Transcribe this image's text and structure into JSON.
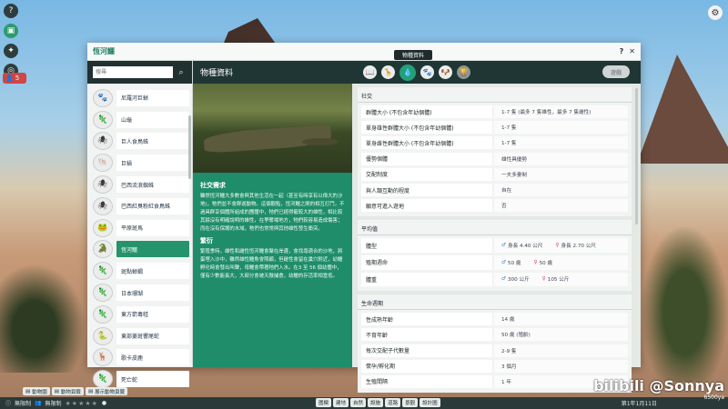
{
  "hud": {
    "guest_count": "5",
    "settings_icon": "gear-icon"
  },
  "window": {
    "title": "恆河鱷",
    "help": "?",
    "close": "✕",
    "tooltip": "物種資料"
  },
  "search": {
    "value": "",
    "placeholder": "搜尋"
  },
  "species": [
    {
      "icon": "🐾",
      "label": "尼羅河巨蜥"
    },
    {
      "icon": "🦎",
      "label": "山龜"
    },
    {
      "icon": "🕷",
      "label": "巨人食鳥蛛"
    },
    {
      "icon": "🐚",
      "label": "巨蝸"
    },
    {
      "icon": "🕷",
      "label": "巴西流浪蜘蛛"
    },
    {
      "icon": "🕷",
      "label": "巴西紅臭粉紅食鳥蛛"
    },
    {
      "icon": "🐸",
      "label": "平原斑馬"
    },
    {
      "icon": "🐊",
      "label": "恆河鱷",
      "selected": true
    },
    {
      "icon": "🦎",
      "label": "斑點蜥蝎"
    },
    {
      "icon": "🦎",
      "label": "日本珊瑚"
    },
    {
      "icon": "🦎",
      "label": "東方箭毒蛙"
    },
    {
      "icon": "🐍",
      "label": "東部菱斑響尾蛇"
    },
    {
      "icon": "🦌",
      "label": "歌卡皮鹿"
    },
    {
      "icon": "🦎",
      "label": "死亡蛇"
    }
  ],
  "middle": {
    "header": "物種資料",
    "social_title": "社交需求",
    "social_text": "雖然恆河鱷大多數會與其他生活在一起（甚至有時享有以偉大的沙地)，牠們並不會群遊動物。這個觀點，恆河鱷之間的相互打鬥，不過具群享個體所組成的團體中，牠們已經得寵較大的雄性，相比較其餘沒有明確說明的雄性，在爭奪場地方，牠們較容易造成傷害；而在沒有保護的水域，牠們也常常與其他雄性發生衝突。",
    "breeding_title": "繁衍",
    "breeding_text": "繁殖季時，雄性和雌性恆河鱷會聚在岸邊，會找尋適合的沙地，將蛋埋入沙中，雖然雄性鱷魚會照顧，但雌性會留在巢穴附近，幼鱷孵化時會發出叫聲，母鱷會帶著牠們入水。在3 至 56 個幼體中，僅有少數能長大，大部分會被天敵捕食，幼鱷的存活率相當低。"
  },
  "tabs": [
    {
      "icon": "📖",
      "name": "book-icon"
    },
    {
      "icon": "🦒",
      "name": "giraffe-icon"
    },
    {
      "icon": "💧",
      "name": "droplet-icon",
      "active": true
    },
    {
      "icon": "🐾",
      "name": "paw-icon"
    },
    {
      "icon": "🐶",
      "name": "pet-icon"
    },
    {
      "icon": "🏆",
      "name": "trophy-icon",
      "dim": true
    }
  ],
  "locked_label": "遊戲",
  "social": {
    "title": "社交",
    "rows": [
      {
        "k": "群體大小 (不包含年幼個體)",
        "v": "1-7 隻 (最多 7 隻雄性，最多 7 隻雌性)"
      },
      {
        "k": "單身雄性群體大小 (不包含年幼個體)",
        "v": "1-7 隻"
      },
      {
        "k": "單身雌性群體大小 (不包含年幼個體)",
        "v": "1-7 隻"
      },
      {
        "k": "優勢個體",
        "v": "雄性具優勢"
      },
      {
        "k": "交配制度",
        "v": "一夫多妻制"
      },
      {
        "k": "與人類互動的程度",
        "v": "自在"
      },
      {
        "k": "願意可進入遊地",
        "v": "否"
      }
    ]
  },
  "average": {
    "title": "平均值",
    "rows": [
      {
        "k": "體型",
        "m": "身長 4.40 公尺",
        "f": "身長 2.70 公尺"
      },
      {
        "k": "殖期週命",
        "m": "50 歲",
        "f": "50 歲"
      },
      {
        "k": "體重",
        "m": "300 公斤",
        "f": "105 公斤"
      }
    ]
  },
  "life": {
    "title": "生命週期",
    "rows": [
      {
        "k": "性成熟年齡",
        "v": "14 歲"
      },
      {
        "k": "不育年齡",
        "v": "50 歲 (殖齡)"
      },
      {
        "k": "每次交配子代數量",
        "v": "2-9 隻"
      },
      {
        "k": "懷孕/孵化期",
        "v": "3 個月"
      },
      {
        "k": "生殖間隔",
        "v": "1 年"
      }
    ]
  },
  "bottom": {
    "row1": [
      "動物園",
      "動物頁籤",
      "展示動物頁籤"
    ],
    "money_label": "無限制",
    "guests_label": "無限制",
    "modes": [
      "圍欄",
      "建地",
      "自然",
      "設施",
      "道路",
      "景觀",
      "設計圖"
    ],
    "date": "第1年1月11日"
  },
  "watermark": {
    "brand": "bilibili @Sonnya",
    "sub": "6500ya"
  }
}
